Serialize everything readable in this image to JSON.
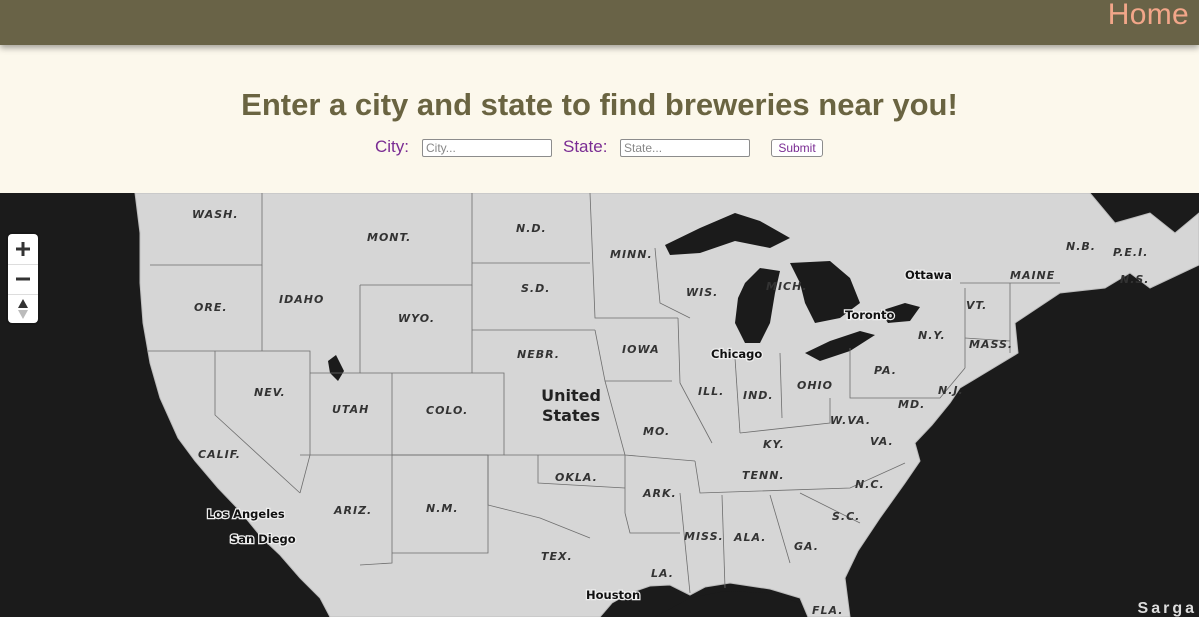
{
  "nav": {
    "home_label": "Home"
  },
  "search": {
    "headline": "Enter a city and state to find breweries near you!",
    "city_label": "City:",
    "city_placeholder": "City...",
    "state_label": "State:",
    "state_placeholder": "State...",
    "submit_label": "Submit"
  },
  "map": {
    "controls": {
      "zoom_in": "plus-icon",
      "zoom_out": "minus-icon",
      "compass": "compass-icon"
    },
    "country": [
      "United",
      "States"
    ],
    "states": [
      "WASH.",
      "MONT.",
      "N.D.",
      "MINN.",
      "ORE.",
      "IDAHO",
      "S.D.",
      "WYO.",
      "WIS.",
      "MICH.",
      "NEBR.",
      "IOWA",
      "NEV.",
      "UTAH",
      "COLO.",
      "ILL.",
      "IND.",
      "OHIO",
      "PA.",
      "N.Y.",
      "CALIF.",
      "MO.",
      "KY.",
      "W.VA.",
      "VA.",
      "MD.",
      "N.J.",
      "TENN.",
      "N.C.",
      "OKLA.",
      "ARK.",
      "ARIZ.",
      "N.M.",
      "S.C.",
      "MISS.",
      "ALA.",
      "GA.",
      "TEX.",
      "LA.",
      "FLA.",
      "VT.",
      "MASS.",
      "MAINE",
      "N.B.",
      "P.E.I.",
      "N.S."
    ],
    "cities": [
      "Ottawa",
      "Toronto",
      "Chicago",
      "Los Angeles",
      "San Diego",
      "Houston"
    ],
    "attribution": "Sarga",
    "colors": {
      "land": "#d6d6d6",
      "water": "#1b1b1b",
      "border": "#666666"
    }
  }
}
